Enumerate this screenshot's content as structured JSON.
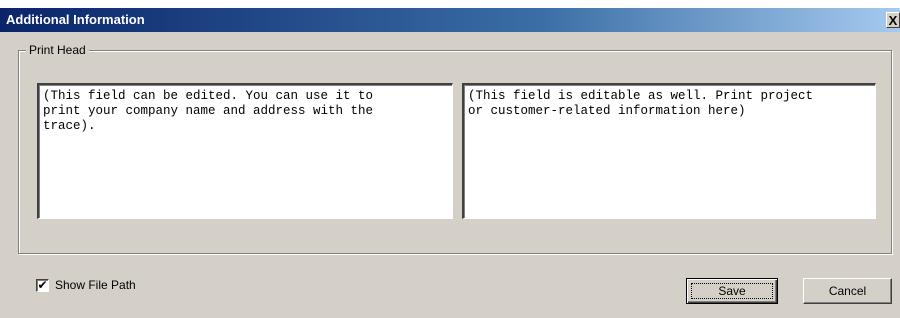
{
  "window": {
    "title": "Additional Information",
    "close_glyph": "X"
  },
  "print_head": {
    "legend": "Print Head",
    "left_text": "(This field can be edited. You can use it to\nprint your company name and address with the\ntrace).",
    "right_text": "(This field is editable as well. Print project\nor customer-related information here)"
  },
  "options": {
    "show_file_path_label": "Show File Path",
    "show_file_path_checked": true,
    "check_glyph": "✔"
  },
  "buttons": {
    "save_label": "Save",
    "cancel_label": "Cancel"
  },
  "colors": {
    "dialog_face": "#d4d0c8",
    "title_gradient_start": "#0a246a",
    "title_gradient_end": "#a6caf0",
    "title_text": "#ffffff"
  }
}
